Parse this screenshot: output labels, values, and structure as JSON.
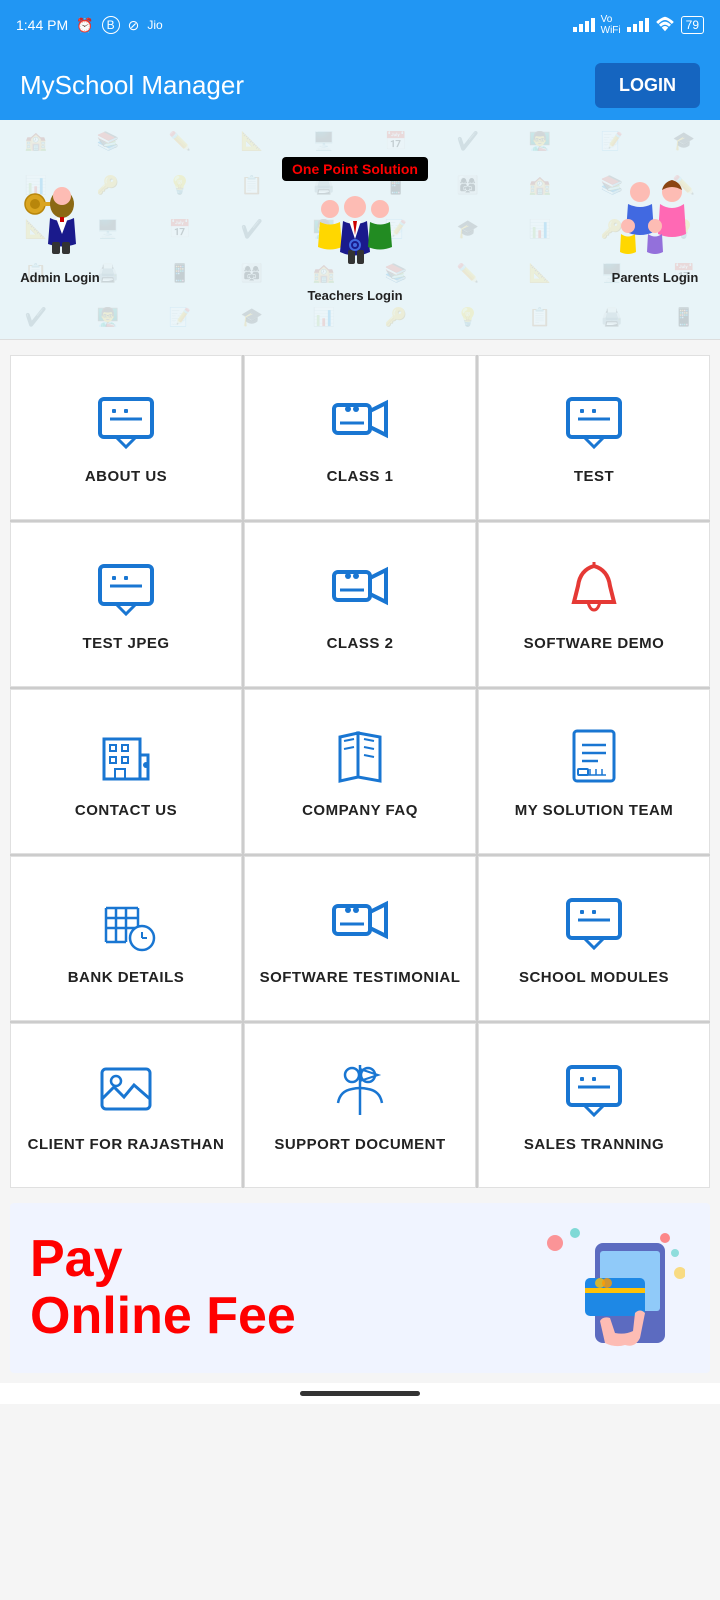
{
  "statusBar": {
    "time": "1:44 PM",
    "battery": "79"
  },
  "appBar": {
    "title": "MySchool Manager",
    "loginLabel": "LOGIN"
  },
  "banner": {
    "tagline": "One Point Solution",
    "adminLabel": "Admin Login",
    "teachersLabel": "Teachers Login",
    "parentsLabel": "Parents Login"
  },
  "grid": {
    "items": [
      {
        "id": "about-us",
        "label": "ABOUT US",
        "icon": "info-chat"
      },
      {
        "id": "class-1",
        "label": "CLASS 1",
        "icon": "video-camera"
      },
      {
        "id": "test",
        "label": "TEST",
        "icon": "info-chat"
      },
      {
        "id": "test-jpeg",
        "label": "TEST JPEG",
        "icon": "info-chat"
      },
      {
        "id": "class-2",
        "label": "CLASS 2",
        "icon": "video-camera"
      },
      {
        "id": "software-demo",
        "label": "SOFTWARE DEMO",
        "icon": "bell"
      },
      {
        "id": "contact-us",
        "label": "CONTACT US",
        "icon": "building"
      },
      {
        "id": "company-faq",
        "label": "COMPANY FAQ",
        "icon": "book"
      },
      {
        "id": "my-solution-team",
        "label": "MY SOLUTION TEAM",
        "icon": "document"
      },
      {
        "id": "bank-details",
        "label": "BANK DETAILS",
        "icon": "grid-clock"
      },
      {
        "id": "software-testimonial",
        "label": "SOFTWARE TESTIMONIAL",
        "icon": "video-camera"
      },
      {
        "id": "school-modules",
        "label": "SCHOOL MODULES",
        "icon": "info-chat"
      },
      {
        "id": "client-rajasthan",
        "label": "CLIENT FOR RAJASTHAN",
        "icon": "image"
      },
      {
        "id": "support-document",
        "label": "SUPPORT DOCUMENT",
        "icon": "people-flag"
      },
      {
        "id": "sales-tranning",
        "label": "SALES TRANNING",
        "icon": "info-chat"
      }
    ]
  },
  "bottomBanner": {
    "line1": "Pay",
    "line2": "Online Fee"
  }
}
